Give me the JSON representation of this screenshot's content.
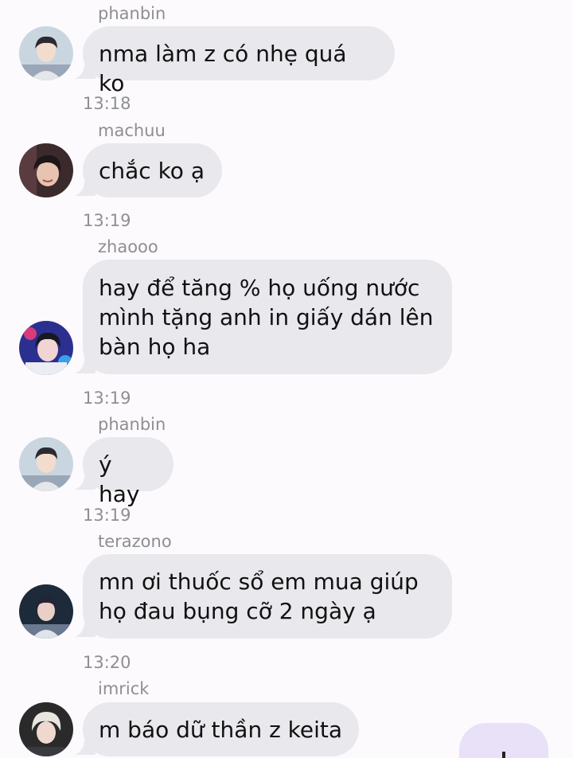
{
  "messages": [
    {
      "sender": "phanbin",
      "text": "nma làm z có nhẹ quá ko",
      "time": "13:18",
      "avatar": "avatar-phanbin-icon"
    },
    {
      "sender": "machuu",
      "text": "chắc ko ạ",
      "time": "13:19",
      "avatar": "avatar-machuu-icon"
    },
    {
      "sender": "zhaooo",
      "text": "hay để tăng % họ uống nước\nmình tặng anh in giấy dán lên\nbàn họ ha",
      "time": "13:19",
      "avatar": "avatar-zhaooo-icon"
    },
    {
      "sender": "phanbin",
      "text": "ý hay",
      "time": "13:19",
      "avatar": "avatar-phanbin-icon"
    },
    {
      "sender": "terazono",
      "text": "mn ơi thuốc sổ em mua giúp\nhọ đau bụng cỡ 2 ngày ạ",
      "time": "13:20",
      "avatar": "avatar-terazono-icon"
    },
    {
      "sender": "imrick",
      "text": "m báo dữ thần z keita",
      "time": "",
      "avatar": "avatar-imrick-icon"
    }
  ],
  "colors": {
    "background": "#fcfafd",
    "bubble_incoming": "#e8e8ed",
    "bubble_outgoing": "#e9e1f7",
    "meta_text": "#8e8e93"
  }
}
